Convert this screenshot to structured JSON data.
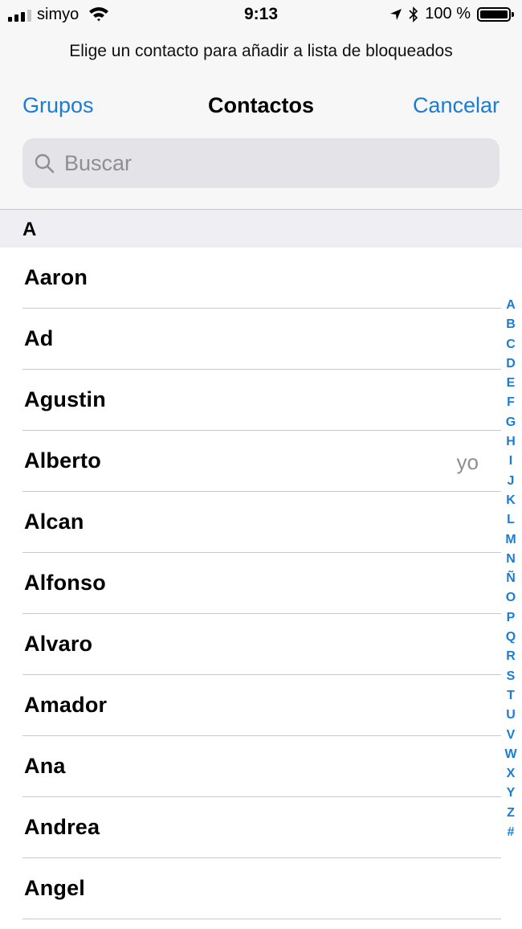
{
  "status_bar": {
    "carrier": "simyo",
    "time": "9:13",
    "battery": "100 %",
    "signal_bars_filled": 3,
    "signal_bars_total": 4
  },
  "prompt": "Elige un contacto para añadir a lista de bloqueados",
  "nav": {
    "left": "Grupos",
    "title": "Contactos",
    "right": "Cancelar"
  },
  "search": {
    "placeholder": "Buscar"
  },
  "section": "A",
  "contacts": [
    {
      "name": "Aaron"
    },
    {
      "name": "Ad"
    },
    {
      "name": "Agustin"
    },
    {
      "name": "Alberto",
      "note": "yo"
    },
    {
      "name": "Alcan"
    },
    {
      "name": "Alfonso"
    },
    {
      "name": "Alvaro"
    },
    {
      "name": "Amador"
    },
    {
      "name": "Ana"
    },
    {
      "name": "Andrea"
    },
    {
      "name": "Angel"
    }
  ],
  "index": [
    "A",
    "B",
    "C",
    "D",
    "E",
    "F",
    "G",
    "H",
    "I",
    "J",
    "K",
    "L",
    "M",
    "N",
    "Ñ",
    "O",
    "P",
    "Q",
    "R",
    "S",
    "T",
    "U",
    "V",
    "W",
    "X",
    "Y",
    "Z",
    "#"
  ],
  "colors": {
    "accent": "#1a7cd6",
    "header_bg": "#f7f7f7",
    "section_bg": "#efeff3",
    "separator": "#c8c7cc"
  }
}
